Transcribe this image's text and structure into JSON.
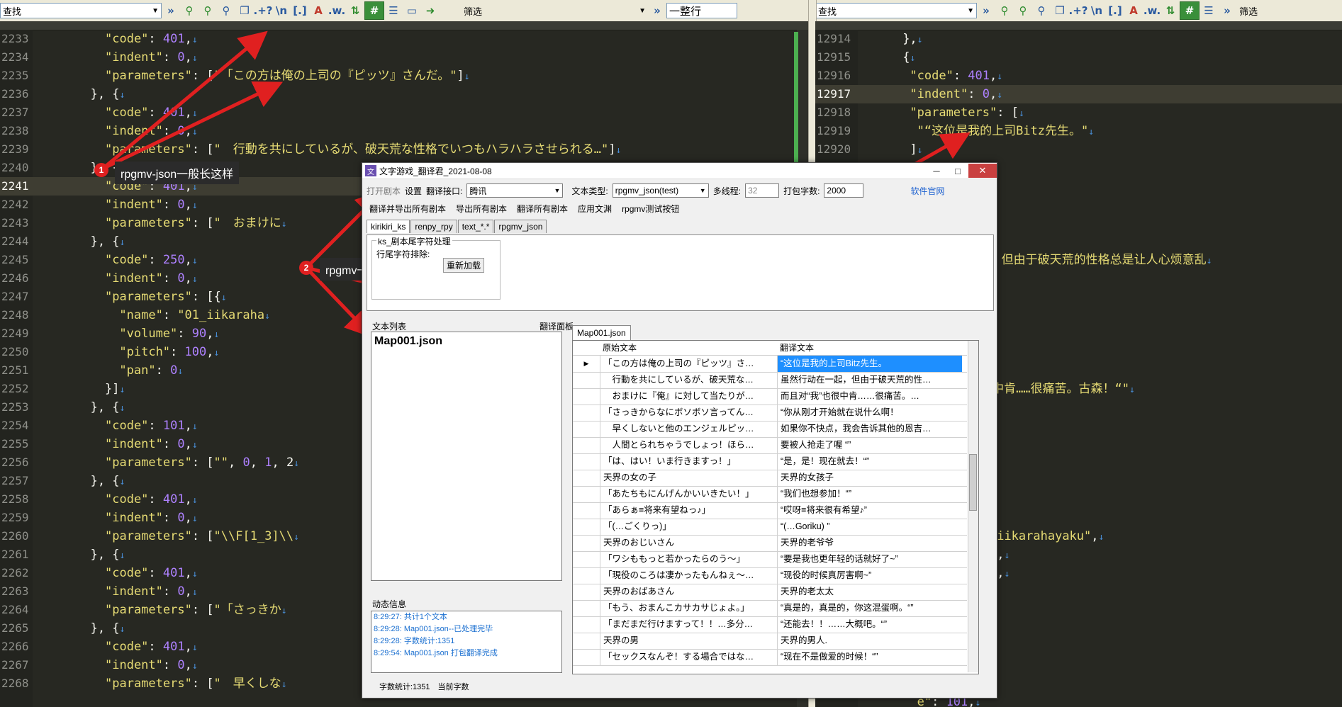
{
  "left_toolbar": {
    "find_label": "查找",
    "filter_label": "筛选",
    "line_mode": "一整行"
  },
  "right_toolbar": {
    "find_label": "查找",
    "filter_label": "筛选"
  },
  "left_editor": {
    "lines": [
      {
        "n": "2233",
        "i": 10,
        "t": [
          [
            "k",
            "\"code\""
          ],
          [
            "p",
            ": "
          ],
          [
            "n",
            "401"
          ],
          [
            "p",
            ","
          ]
        ]
      },
      {
        "n": "2234",
        "i": 10,
        "t": [
          [
            "k",
            "\"indent\""
          ],
          [
            "p",
            ": "
          ],
          [
            "n",
            "0"
          ],
          [
            "p",
            ","
          ]
        ]
      },
      {
        "n": "2235",
        "i": 10,
        "t": [
          [
            "k",
            "\"parameters\""
          ],
          [
            "p",
            ": ["
          ],
          [
            "s",
            "\"「この方は俺の上司の『ピッツ』さんだ。\""
          ],
          [
            "p",
            "]"
          ]
        ]
      },
      {
        "n": "2236",
        "i": 8,
        "t": [
          [
            "p",
            "}, {"
          ]
        ]
      },
      {
        "n": "2237",
        "i": 10,
        "t": [
          [
            "k",
            "\"code\""
          ],
          [
            "p",
            ": "
          ],
          [
            "n",
            "401"
          ],
          [
            "p",
            ","
          ]
        ]
      },
      {
        "n": "2238",
        "i": 10,
        "t": [
          [
            "k",
            "\"indent\""
          ],
          [
            "p",
            ": "
          ],
          [
            "n",
            "0"
          ],
          [
            "p",
            ","
          ]
        ]
      },
      {
        "n": "2239",
        "i": 10,
        "t": [
          [
            "k",
            "\"parameters\""
          ],
          [
            "p",
            ": ["
          ],
          [
            "s",
            "\"　行動を共にしているが、破天荒な性格でいつもハラハラさせられる…\""
          ],
          [
            "p",
            "]"
          ]
        ]
      },
      {
        "n": "2240",
        "i": 8,
        "t": [
          [
            "p",
            "}, {"
          ]
        ]
      },
      {
        "n": "2241",
        "i": 10,
        "t": [
          [
            "k",
            "\"code\""
          ],
          [
            "p",
            ": "
          ],
          [
            "n",
            "401"
          ],
          [
            "p",
            ","
          ]
        ],
        "hl": true
      },
      {
        "n": "2242",
        "i": 10,
        "t": [
          [
            "k",
            "\"indent\""
          ],
          [
            "p",
            ": "
          ],
          [
            "n",
            "0"
          ],
          [
            "p",
            ","
          ]
        ]
      },
      {
        "n": "2243",
        "i": 10,
        "t": [
          [
            "k",
            "\"parameters\""
          ],
          [
            "p",
            ": ["
          ],
          [
            "s",
            "\"　おまけに"
          ]
        ]
      },
      {
        "n": "2244",
        "i": 8,
        "t": [
          [
            "p",
            "}, {"
          ]
        ]
      },
      {
        "n": "2245",
        "i": 10,
        "t": [
          [
            "k",
            "\"code\""
          ],
          [
            "p",
            ": "
          ],
          [
            "n",
            "250"
          ],
          [
            "p",
            ","
          ]
        ]
      },
      {
        "n": "2246",
        "i": 10,
        "t": [
          [
            "k",
            "\"indent\""
          ],
          [
            "p",
            ": "
          ],
          [
            "n",
            "0"
          ],
          [
            "p",
            ","
          ]
        ]
      },
      {
        "n": "2247",
        "i": 10,
        "t": [
          [
            "k",
            "\"parameters\""
          ],
          [
            "p",
            ": [{"
          ]
        ]
      },
      {
        "n": "2248",
        "i": 12,
        "t": [
          [
            "k",
            "\"name\""
          ],
          [
            "p",
            ": "
          ],
          [
            "s",
            "\"01_iikaraha"
          ]
        ]
      },
      {
        "n": "2249",
        "i": 12,
        "t": [
          [
            "k",
            "\"volume\""
          ],
          [
            "p",
            ": "
          ],
          [
            "n",
            "90"
          ],
          [
            "p",
            ","
          ]
        ]
      },
      {
        "n": "2250",
        "i": 12,
        "t": [
          [
            "k",
            "\"pitch\""
          ],
          [
            "p",
            ": "
          ],
          [
            "n",
            "100"
          ],
          [
            "p",
            ","
          ]
        ]
      },
      {
        "n": "2251",
        "i": 12,
        "t": [
          [
            "k",
            "\"pan\""
          ],
          [
            "p",
            ": "
          ],
          [
            "n",
            "0"
          ]
        ]
      },
      {
        "n": "2252",
        "i": 10,
        "t": [
          [
            "p",
            "}]"
          ]
        ]
      },
      {
        "n": "2253",
        "i": 8,
        "t": [
          [
            "p",
            "}, {"
          ]
        ]
      },
      {
        "n": "2254",
        "i": 10,
        "t": [
          [
            "k",
            "\"code\""
          ],
          [
            "p",
            ": "
          ],
          [
            "n",
            "101"
          ],
          [
            "p",
            ","
          ]
        ]
      },
      {
        "n": "2255",
        "i": 10,
        "t": [
          [
            "k",
            "\"indent\""
          ],
          [
            "p",
            ": "
          ],
          [
            "n",
            "0"
          ],
          [
            "p",
            ","
          ]
        ]
      },
      {
        "n": "2256",
        "i": 10,
        "t": [
          [
            "k",
            "\"parameters\""
          ],
          [
            "p",
            ": ["
          ],
          [
            "s",
            "\"\""
          ],
          [
            "p",
            ", "
          ],
          [
            "n",
            "0"
          ],
          [
            "p",
            ", "
          ],
          [
            "n",
            "1"
          ],
          [
            "p",
            ", 2"
          ]
        ]
      },
      {
        "n": "2257",
        "i": 8,
        "t": [
          [
            "p",
            "}, {"
          ]
        ]
      },
      {
        "n": "2258",
        "i": 10,
        "t": [
          [
            "k",
            "\"code\""
          ],
          [
            "p",
            ": "
          ],
          [
            "n",
            "401"
          ],
          [
            "p",
            ","
          ]
        ]
      },
      {
        "n": "2259",
        "i": 10,
        "t": [
          [
            "k",
            "\"indent\""
          ],
          [
            "p",
            ": "
          ],
          [
            "n",
            "0"
          ],
          [
            "p",
            ","
          ]
        ]
      },
      {
        "n": "2260",
        "i": 10,
        "t": [
          [
            "k",
            "\"parameters\""
          ],
          [
            "p",
            ": ["
          ],
          [
            "s",
            "\"\\\\F[1_3]\\\\"
          ]
        ]
      },
      {
        "n": "2261",
        "i": 8,
        "t": [
          [
            "p",
            "}, {"
          ]
        ]
      },
      {
        "n": "2262",
        "i": 10,
        "t": [
          [
            "k",
            "\"code\""
          ],
          [
            "p",
            ": "
          ],
          [
            "n",
            "401"
          ],
          [
            "p",
            ","
          ]
        ]
      },
      {
        "n": "2263",
        "i": 10,
        "t": [
          [
            "k",
            "\"indent\""
          ],
          [
            "p",
            ": "
          ],
          [
            "n",
            "0"
          ],
          [
            "p",
            ","
          ]
        ]
      },
      {
        "n": "2264",
        "i": 10,
        "t": [
          [
            "k",
            "\"parameters\""
          ],
          [
            "p",
            ": ["
          ],
          [
            "s",
            "\"「さっきか"
          ]
        ]
      },
      {
        "n": "2265",
        "i": 8,
        "t": [
          [
            "p",
            "}, {"
          ]
        ]
      },
      {
        "n": "2266",
        "i": 10,
        "t": [
          [
            "k",
            "\"code\""
          ],
          [
            "p",
            ": "
          ],
          [
            "n",
            "401"
          ],
          [
            "p",
            ","
          ]
        ]
      },
      {
        "n": "2267",
        "i": 10,
        "t": [
          [
            "k",
            "\"indent\""
          ],
          [
            "p",
            ": "
          ],
          [
            "n",
            "0"
          ],
          [
            "p",
            ","
          ]
        ]
      },
      {
        "n": "2268",
        "i": 10,
        "t": [
          [
            "k",
            "\"parameters\""
          ],
          [
            "p",
            ": ["
          ],
          [
            "s",
            "\"　早くしな"
          ]
        ]
      }
    ]
  },
  "right_editor": {
    "lines": [
      {
        "n": "12914",
        "i": 6,
        "t": [
          [
            "p",
            "},"
          ]
        ]
      },
      {
        "n": "12915",
        "i": 6,
        "t": [
          [
            "p",
            "{"
          ]
        ]
      },
      {
        "n": "12916",
        "i": 7,
        "t": [
          [
            "k",
            "\"code\""
          ],
          [
            "p",
            ": "
          ],
          [
            "n",
            "401"
          ],
          [
            "p",
            ","
          ]
        ]
      },
      {
        "n": "12917",
        "i": 7,
        "t": [
          [
            "k",
            "\"indent\""
          ],
          [
            "p",
            ": "
          ],
          [
            "n",
            "0"
          ],
          [
            "p",
            ","
          ]
        ],
        "hl": true
      },
      {
        "n": "12918",
        "i": 7,
        "t": [
          [
            "k",
            "\"parameters\""
          ],
          [
            "p",
            ": ["
          ]
        ]
      },
      {
        "n": "12919",
        "i": 8,
        "t": [
          [
            "s",
            "\"“这位是我的上司Bitz先生。\""
          ]
        ]
      },
      {
        "n": "12920",
        "i": 7,
        "t": [
          [
            "p",
            "]"
          ]
        ]
      },
      {
        "n": "",
        "i": 0,
        "t": []
      },
      {
        "n": "",
        "i": 0,
        "t": []
      },
      {
        "n": "",
        "i": 8,
        "t": [
          [
            "k",
            "e\""
          ],
          [
            "p",
            ": "
          ],
          [
            "n",
            "401"
          ],
          [
            "p",
            ","
          ]
        ]
      },
      {
        "n": "",
        "i": 8,
        "t": [
          [
            "k",
            "nt\""
          ],
          [
            "p",
            ": "
          ],
          [
            "n",
            "0"
          ],
          [
            "p",
            ","
          ]
        ]
      },
      {
        "n": "",
        "i": 8,
        "t": [
          [
            "k",
            "meters\""
          ],
          [
            "p",
            ": ["
          ]
        ]
      },
      {
        "n": "",
        "i": 8,
        "t": [
          [
            "s",
            "然行动在一起，但由于破天荒的性格总是让人心烦意乱"
          ]
        ]
      },
      {
        "n": "",
        "i": 0,
        "t": []
      },
      {
        "n": "",
        "i": 0,
        "t": []
      },
      {
        "n": "",
        "i": 0,
        "t": []
      },
      {
        "n": "",
        "i": 8,
        "t": [
          [
            "k",
            "e\""
          ],
          [
            "p",
            ": "
          ],
          [
            "n",
            "401"
          ],
          [
            "p",
            ","
          ]
        ]
      },
      {
        "n": "",
        "i": 8,
        "t": [
          [
            "k",
            "nt\""
          ],
          [
            "p",
            ": "
          ],
          [
            "n",
            "0"
          ],
          [
            "p",
            ","
          ]
        ]
      },
      {
        "n": "",
        "i": 8,
        "t": [
          [
            "k",
            "meters\""
          ],
          [
            "p",
            ": ["
          ]
        ]
      },
      {
        "n": "",
        "i": 8,
        "t": [
          [
            "s",
            "且对“我”也很中肯……很痛苦。古森！“\""
          ]
        ]
      },
      {
        "n": "",
        "i": 0,
        "t": []
      },
      {
        "n": "",
        "i": 0,
        "t": []
      },
      {
        "n": "",
        "i": 0,
        "t": []
      },
      {
        "n": "",
        "i": 8,
        "t": [
          [
            "k",
            "e\""
          ],
          [
            "p",
            ": "
          ],
          [
            "n",
            "250"
          ],
          [
            "p",
            ","
          ]
        ]
      },
      {
        "n": "",
        "i": 8,
        "t": [
          [
            "k",
            "nt\""
          ],
          [
            "p",
            ": "
          ],
          [
            "n",
            "0"
          ],
          [
            "p",
            ","
          ]
        ]
      },
      {
        "n": "",
        "i": 8,
        "t": [
          [
            "k",
            "meters\""
          ],
          [
            "p",
            ": ["
          ]
        ]
      },
      {
        "n": "",
        "i": 0,
        "t": []
      },
      {
        "n": "",
        "i": 8,
        "t": [
          [
            "k",
            "name\""
          ],
          [
            "p",
            ": "
          ],
          [
            "s",
            "\"01_iikarahayaku\""
          ],
          [
            "p",
            ","
          ]
        ]
      },
      {
        "n": "",
        "i": 8,
        "t": [
          [
            "k",
            "volume\""
          ],
          [
            "p",
            ": "
          ],
          [
            "n",
            "90"
          ],
          [
            "p",
            ","
          ]
        ]
      },
      {
        "n": "",
        "i": 8,
        "t": [
          [
            "k",
            "pitch\""
          ],
          [
            "p",
            ": "
          ],
          [
            "n",
            "100"
          ],
          [
            "p",
            ","
          ]
        ]
      },
      {
        "n": "",
        "i": 8,
        "t": [
          [
            "k",
            "pan\""
          ],
          [
            "p",
            ": "
          ],
          [
            "n",
            "0"
          ]
        ]
      },
      {
        "n": "",
        "i": 0,
        "t": []
      },
      {
        "n": "",
        "i": 0,
        "t": []
      },
      {
        "n": "",
        "i": 0,
        "t": []
      },
      {
        "n": "",
        "i": 0,
        "t": []
      },
      {
        "n": "",
        "i": 0,
        "t": []
      },
      {
        "n": "",
        "i": 8,
        "t": [
          [
            "k",
            "e\""
          ],
          [
            "p",
            ": "
          ],
          [
            "n",
            "101"
          ],
          [
            "p",
            ","
          ]
        ]
      }
    ]
  },
  "annotations": {
    "c1": "rpgmv-json一般长这样",
    "c2": "rpgmv一键翻译暂时只支持Mapxxx数字的json格式",
    "b1": "1",
    "b2": "2",
    "b3": "3",
    "b4": "4"
  },
  "dialog": {
    "title": "文字游戏_翻译君_2021-08-08",
    "open_script": "打开剧本",
    "settings": "设置",
    "api_label": "翻译接口:",
    "api_value": "腾讯",
    "type_label": "文本类型:",
    "type_value": "rpgmv_json(test)",
    "threads_label": "多线程:",
    "threads_value": "32",
    "pack_label": "打包字数:",
    "pack_value": "2000",
    "website": "软件官网",
    "actions": [
      "翻译并导出所有剧本",
      "导出所有剧本",
      "翻译所有剧本",
      "应用文渊",
      "rpgmv测试按钮"
    ],
    "tabs": [
      "kirikiri_ks",
      "renpy_rpy",
      "text_*.*",
      "rpgmv_json"
    ],
    "group_title": "ks_剧本尾字符处理",
    "group_line1": "行尾字符排除:",
    "reload": "重新加载",
    "file_list_label": "文本列表",
    "files": [
      "Map001.json"
    ],
    "trans_panel_label": "翻译面板",
    "trans_tab": "Map001.json",
    "col_src": "原始文本",
    "col_dst": "翻译文本",
    "rows": [
      [
        "「この方は俺の上司の『ピッツ』さ…",
        "“这位是我的上司Bitz先生。"
      ],
      [
        "　行動を共にしているが、破天荒な…",
        "虽然行动在一起，但由于破天荒的性…"
      ],
      [
        "　おまけに『俺』に対して当たりが…",
        "而且对“我”也很中肯……很痛苦。…"
      ],
      [
        "「さっきからなにボソボソ言ってん…",
        "“你从刚才开始就在说什么啊！"
      ],
      [
        "　早くしないと他のエンジェルピッ…",
        "如果你不快点，我会告诉其他的恩吉…"
      ],
      [
        "　人間とられちゃうでしょっ！ほら…",
        "要被人抢走了喔  “”"
      ],
      [
        "「は、はい！いま行きますっ！」",
        "“是，是！现在就去！“”"
      ],
      [
        "天界の女の子",
        "天界的女孩子"
      ],
      [
        "「あたちもにんげんかいいきたい！」",
        "“我们也想参加！“”"
      ],
      [
        "「あらぁ≡将来有望ねっ♪」",
        "“哎呀≡将来很有希望♪”"
      ],
      [
        "「(…ごくりっ)」",
        "“(…Goriku) ”"
      ],
      [
        "天界のおじいさん",
        "天界的老爷爷"
      ],
      [
        "「ワシももっと若かったらのう～」",
        "“要是我也更年轻的话就好了~”"
      ],
      [
        "「現役のころは凄かったもんねぇ～…",
        "“现役的时候真厉害啊~”"
      ],
      [
        "天界のおばあさん",
        "天界的老太太"
      ],
      [
        "「もう、おまんこカサカサじょよ。」",
        "“真是的，真是的，你这混蛋啊。“”"
      ],
      [
        "「まだまだ行けますって！！…多分…",
        "“还能去！！……大概吧。“”"
      ],
      [
        "天界の男",
        "天界的男人."
      ],
      [
        "「セックスなんぞ！する場合ではな…",
        "“现在不是做爱的时候！“”"
      ]
    ],
    "log_label": "动态信息",
    "log": [
      "8:29:27: 共计1个文本",
      "8:29:28: Map001.json--已处理完毕",
      "8:29:28: 字数统计:1351",
      "8:29:54: Map001.json 打包翻译完成"
    ],
    "status": "字数统计:1351　当前字数"
  }
}
